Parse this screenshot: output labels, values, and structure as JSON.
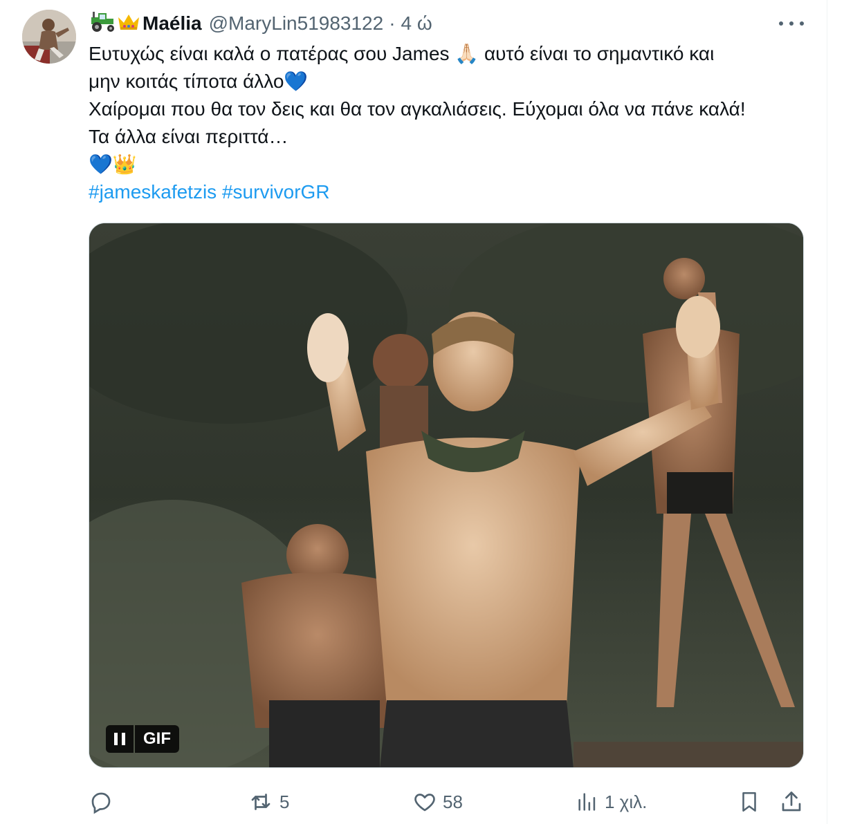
{
  "tweet": {
    "author_emoji_1": "🚜",
    "author_emoji_2": "👑",
    "display_name": "Maélia",
    "handle": "@MaryLin51983122",
    "separator": "·",
    "time": "4 ώ",
    "text_lines": [
      "Ευτυχώς είναι καλά ο πατέρας σου James 🙏🏻 αυτό είναι το σημαντικό και",
      "μην κοιτάς τίποτα άλλο💙",
      "Χαίρομαι που θα τον δεις και θα τον αγκαλιάσεις. Εύχομαι όλα να πάνε καλά!",
      "Τα άλλα είναι περιττά…",
      "💙👑"
    ],
    "hashtags": [
      "#jameskafetzis",
      "#survivorGR"
    ],
    "media": {
      "type": "GIF",
      "gif_label": "GIF"
    },
    "actions": {
      "reply_count": "",
      "retweet_count": "5",
      "like_count": "58",
      "views_count": "1 χιλ."
    }
  },
  "icons": {
    "reply": "reply-icon",
    "retweet": "retweet-icon",
    "like": "heart-icon",
    "views": "views-icon",
    "bookmark": "bookmark-icon",
    "share": "share-icon",
    "more": "more-icon",
    "pause": "pause-icon"
  },
  "colors": {
    "text": "#0f1419",
    "secondary": "#536471",
    "link": "#1d9bf0"
  }
}
